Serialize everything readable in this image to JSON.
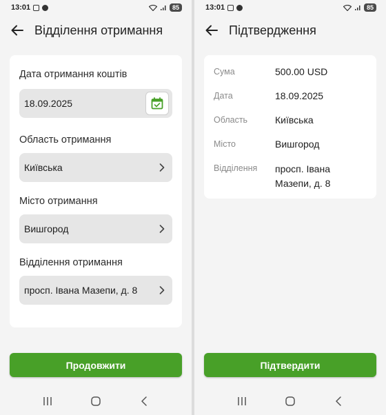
{
  "left": {
    "status": {
      "time": "13:01",
      "battery": "85"
    },
    "title": "Відділення отримання",
    "fields": [
      {
        "label": "Дата отримання коштів",
        "value": "18.09.2025"
      },
      {
        "label": "Область отримання",
        "value": "Київська"
      },
      {
        "label": "Місто отримання",
        "value": "Вишгород"
      },
      {
        "label": "Відділення отримання",
        "value": "просп. Івана Мазепи, д. 8"
      }
    ],
    "button": "Продовжити"
  },
  "right": {
    "status": {
      "time": "13:01",
      "battery": "85"
    },
    "title": "Підтвердження",
    "rows": [
      {
        "key": "Сума",
        "value": "500.00 USD"
      },
      {
        "key": "Дата",
        "value": "18.09.2025"
      },
      {
        "key": "Область",
        "value": "Київська"
      },
      {
        "key": "Місто",
        "value": "Вишгород"
      },
      {
        "key": "Відділення",
        "value": "просп. Івана Мазепи, д. 8"
      }
    ],
    "button": "Підтвердити"
  },
  "colors": {
    "accent": "#48a028",
    "background": "#f4f4f4",
    "card": "#ffffff",
    "field": "#e6e6e6"
  },
  "icons": [
    "back-arrow-icon",
    "calendar-icon",
    "chevron-right-icon",
    "recents-icon",
    "home-icon",
    "back-nav-icon"
  ]
}
